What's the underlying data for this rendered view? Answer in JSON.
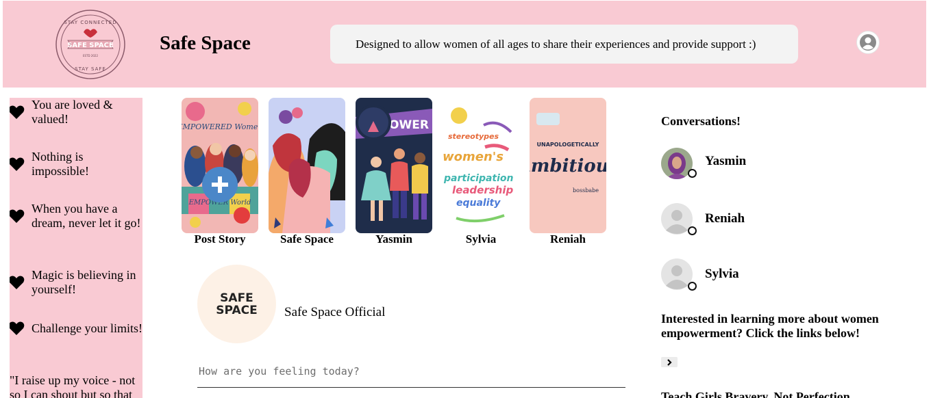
{
  "header": {
    "logo": {
      "top_text": "STAY CONNECTED",
      "main_text": "SAFE SPACE",
      "est_text": "ESTD   2022",
      "bottom_text": "STAY SAFE"
    },
    "brand": "Safe Space",
    "tagline": "Designed to allow women of all ages to share their experiences and provide support :)",
    "profile_icon": "user-circle-icon"
  },
  "affirmations": [
    {
      "icon": "heart-icon",
      "text": "You are loved & valued!"
    },
    {
      "icon": "heart-icon",
      "text": "Nothing is impossible!"
    },
    {
      "icon": "heart-icon",
      "text": "When you have a dream, never let it go!"
    },
    {
      "icon": "heart-icon",
      "text": "Magic is believing in yourself!"
    },
    {
      "icon": "heart-icon",
      "text": "Challenge your limits!"
    }
  ],
  "quote": "\"I raise up my voice - not so I can shout but so that",
  "stories": [
    {
      "label": "Post Story",
      "thumb_text": [
        "EMPOWERED Women",
        "EMPOWER World"
      ]
    },
    {
      "label": "Safe Space"
    },
    {
      "label": "Yasmin",
      "thumb_text": [
        "OWER"
      ]
    },
    {
      "label": "Sylvia",
      "thumb_text": [
        "stereotypes",
        "women's",
        "participation",
        "leadership",
        "equality"
      ]
    },
    {
      "label": "Reniah",
      "thumb_text": [
        "UNAPOLOGETICALLY",
        "Ambitious",
        "bossbabe"
      ]
    }
  ],
  "post": {
    "avatar_line1": "SAFE",
    "avatar_line2": "SPACE",
    "name": "Safe Space Official",
    "input_placeholder": "How are you feeling today?"
  },
  "conversations": {
    "title": "Conversations!",
    "items": [
      {
        "name": "Yasmin",
        "avatar": "photo-avatar"
      },
      {
        "name": "Reniah",
        "avatar": "default-avatar"
      },
      {
        "name": "Sylvia",
        "avatar": "default-avatar"
      }
    ]
  },
  "links": {
    "title": "Interested in learning more about women empowerment? Click the links below!",
    "expand_icon": "chevron-right-icon",
    "first_link": "Teach Girls Bravery, Not Perfection"
  },
  "colors": {
    "pink": "#f9cad3",
    "tagline_bg": "#f3f3f3",
    "avatar_bg": "#fdf1e6",
    "add_button": "#4b87c8"
  }
}
